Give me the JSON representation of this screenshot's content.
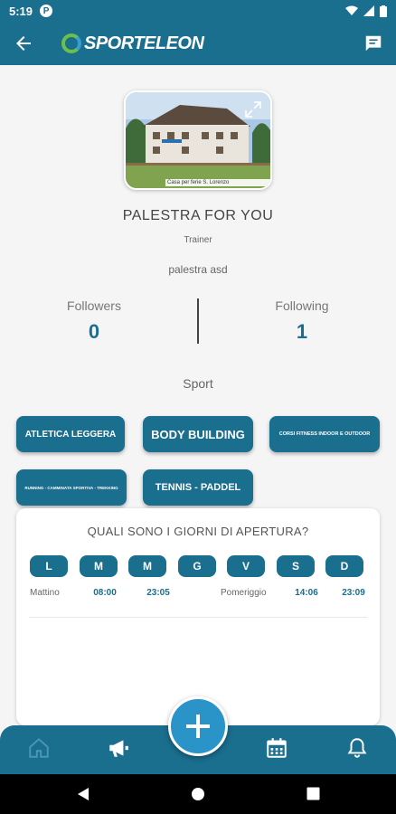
{
  "status": {
    "time": "5:19",
    "badge": "P"
  },
  "appbar": {
    "brand": "SPORTELEON"
  },
  "profile": {
    "cover_caption": "Casa per ferie S. Lorenzo",
    "name": "PALESTRA  FOR YOU",
    "role": "Trainer",
    "handle": "palestra asd"
  },
  "stats": {
    "followers_label": "Followers",
    "followers_value": "0",
    "following_label": "Following",
    "following_value": "1"
  },
  "sport": {
    "title": "Sport",
    "chips": [
      "ATLETICA LEGGERA",
      "BODY BUILDING",
      "CORSI FITNESS INDOOR E OUTDOOR",
      "RUNNING - CAMMINATA SPORTIVA - TREKKING",
      "TENNIS - PADDEL"
    ]
  },
  "opening": {
    "question": "QUALI SONO I GIORNI DI APERTURA?",
    "days": [
      "L",
      "M",
      "M",
      "G",
      "V",
      "S",
      "D"
    ],
    "morning_label": "Mattino",
    "morning_open": "08:00",
    "morning_close": "23:05",
    "afternoon_label": "Pomeriggio",
    "afternoon_open": "14:06",
    "afternoon_close": "23:09"
  },
  "colors": {
    "primary": "#1a6e8e",
    "fab": "#2a93c7"
  }
}
